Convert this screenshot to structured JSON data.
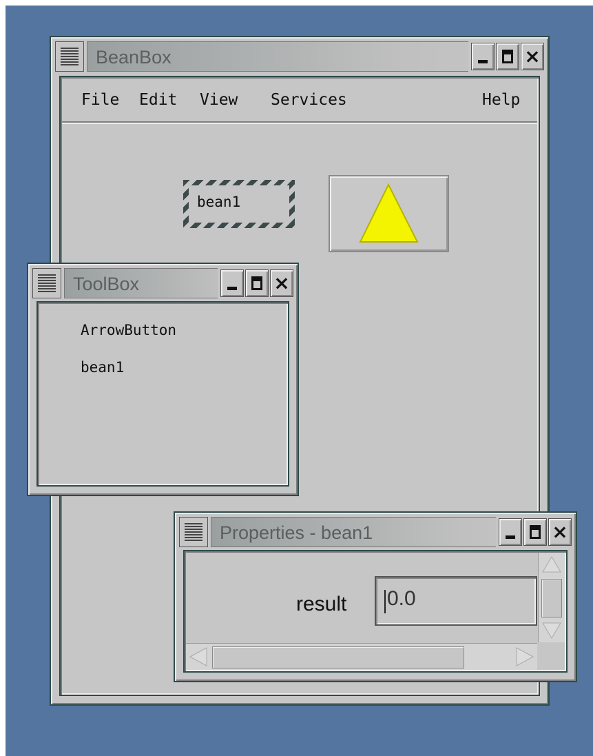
{
  "beanbox": {
    "title": "BeanBox",
    "menu": {
      "file": "File",
      "edit": "Edit",
      "view": "View",
      "services": "Services",
      "help": "Help"
    },
    "bean_label": "bean1"
  },
  "toolbox": {
    "title": "ToolBox",
    "items": [
      "ArrowButton",
      "bean1"
    ]
  },
  "properties": {
    "title": "Properties - bean1",
    "field_label": "result",
    "field_value": "0.0"
  },
  "colors": {
    "desktop": "#5475a0",
    "window": "#c6c6c6",
    "triangle": "#f4f400"
  },
  "icons": [
    "window-menu-icon",
    "minimize-icon",
    "maximize-icon",
    "close-icon",
    "triangle-icon",
    "scroll-up-icon",
    "scroll-down-icon",
    "scroll-left-icon",
    "scroll-right-icon"
  ]
}
